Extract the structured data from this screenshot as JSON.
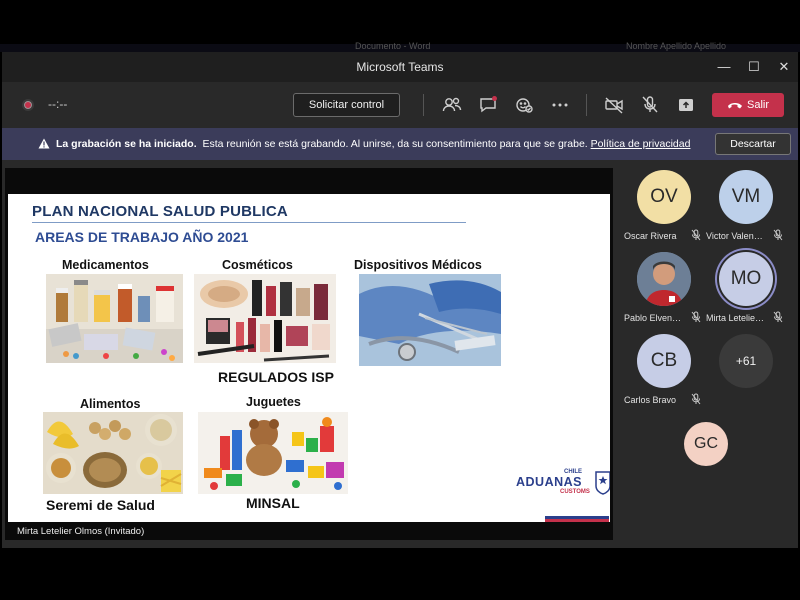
{
  "behind_window": {
    "text_left": "Documento - Word",
    "text_right": "Nombre Apellido Apellido"
  },
  "window": {
    "title": "Microsoft Teams",
    "controls": [
      "—",
      "☐",
      "✕"
    ]
  },
  "toolbar": {
    "timer": "--:--",
    "request_control_label": "Solicitar control",
    "icons": [
      "participants-icon",
      "chat-icon",
      "reactions-icon",
      "more-icon",
      "camera-off-icon",
      "mic-off-icon",
      "share-icon"
    ],
    "leave_label": "Salir"
  },
  "banner": {
    "bold_text": "La grabación se ha iniciado.",
    "text": "Esta reunión se está grabando. Al unirse, da su consentimiento para que se grabe.",
    "link": "Política de privacidad",
    "dismiss_label": "Descartar",
    "background": "#3b3c5a"
  },
  "shared_screen": {
    "presenter_label": "Mirta Letelier Olmos (Invitado)",
    "slide": {
      "title": "PLAN NACIONAL SALUD PUBLICA",
      "subtitle": "AREAS DE TRABAJO AÑO 2021",
      "categories": [
        "Medicamentos",
        "Cosméticos",
        "Dispositivos Médicos",
        "Alimentos",
        "Juguetes"
      ],
      "regulators": [
        "REGULADOS ISP",
        "Seremi de Salud",
        "MINSAL"
      ],
      "logo": {
        "top": "CHILE",
        "main": "ADUANAS",
        "bottom": "CUSTOMS"
      },
      "accent_colors": {
        "navy": "#1f3864",
        "blue": "#2e4c93"
      }
    }
  },
  "participants": [
    {
      "initials": "OV",
      "name": "Oscar Rivera",
      "muted": true,
      "color": "#f2dfa5"
    },
    {
      "initials": "VM",
      "name": "Victor Valenzuela",
      "muted": true,
      "color": "#bdd0ea"
    },
    {
      "initials": "",
      "name": "Pablo Elvensen",
      "muted": true,
      "photo": true
    },
    {
      "initials": "MO",
      "name": "Mirta Letelier Olmos",
      "muted": true,
      "color": "#c6cde6",
      "speaking": true
    },
    {
      "initials": "CB",
      "name": "Carlos Bravo",
      "muted": true,
      "color": "#c6cde6"
    },
    {
      "overflow": "+61"
    },
    {
      "initials": "GC",
      "name": "",
      "color": "#f3d1c4"
    }
  ]
}
